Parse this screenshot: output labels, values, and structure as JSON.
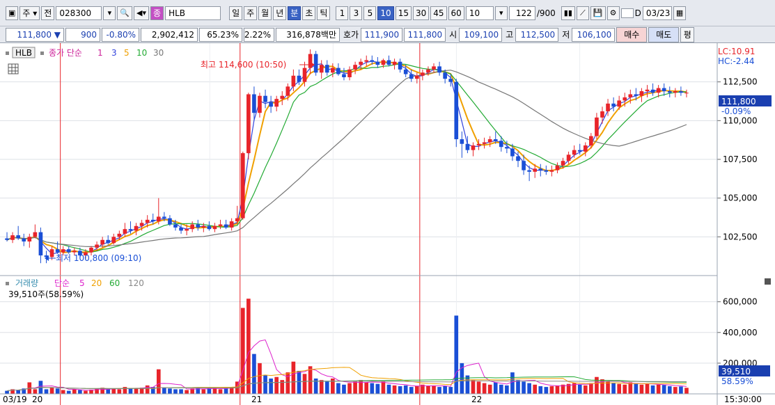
{
  "toolbar": {
    "type_label": "주",
    "prev_label": "전",
    "code": "028300",
    "name_badge": "종",
    "name": "HLB",
    "periods": [
      "일",
      "주",
      "월",
      "년",
      "분",
      "초",
      "틱"
    ],
    "selected_period": "분",
    "intervals": [
      "1",
      "3",
      "5",
      "10",
      "15",
      "30",
      "45",
      "60"
    ],
    "selected_interval": "10",
    "interval_select": "10",
    "count": "122",
    "count_total": "/900",
    "checkbox_label": "D",
    "date": "03/23"
  },
  "quote": {
    "price": "111,800",
    "change": "900",
    "change_pct": "-0.80%",
    "volume": "2,902,412",
    "vol_ratio": "65.23%",
    "turnover": "2.22%",
    "amount": "316,878백만",
    "ask_label": "호가",
    "ask": "111,900",
    "bid": "111,800",
    "open_label": "시",
    "open": "109,100",
    "high_label": "고",
    "high": "112,500",
    "low_label": "저",
    "low": "106,100",
    "buy_label": "매수",
    "sell_label": "매도",
    "eval_label": "평"
  },
  "legend": {
    "stock": "HLB",
    "ma_title": "종가 단순",
    "ma1": "1",
    "ma3": "3",
    "ma5": "5",
    "ma10": "10",
    "ma30": "30",
    "vol_title": "거래량",
    "vol_ma_title": "단순",
    "vma5": "5",
    "vma20": "20",
    "vma60": "60",
    "vma120": "120",
    "vol_info": "39,510주(58.59%)",
    "lc": "LC:10.91",
    "hc": "HC:-2.44"
  },
  "annotations": {
    "high": "최고 114,600 (10:50)",
    "low": "최저 100,800 (09:10)"
  },
  "chart_data": {
    "type": "candlestick",
    "price_ticks": [
      "112,500",
      "110,000",
      "107,500",
      "105,000",
      "102,500"
    ],
    "price_tick_values": [
      112500,
      110000,
      107500,
      105000,
      102500
    ],
    "price_range": [
      100000,
      115000
    ],
    "volume_ticks": [
      "600,000",
      "400,000",
      "200,000"
    ],
    "volume_tick_values": [
      600000,
      400000,
      200000
    ],
    "volume_range": [
      0,
      680000
    ],
    "last_price_label": "111,800",
    "last_change_label": "-0.09%",
    "last_volume_label": "39,510",
    "last_volume_pct_label": "58.59%",
    "time_axis": [
      "03/19",
      "20",
      "21",
      "22"
    ],
    "time_end": "15:30:00",
    "grid": true,
    "colors": {
      "up": "#e8242a",
      "down": "#1a4fd6",
      "ma3": "#3344dd",
      "ma5": "#f0a000",
      "ma10": "#22aa33",
      "ma30": "#777777",
      "vma5": "#dd22cc",
      "vma20": "#f0a000",
      "vma60": "#22aa33",
      "vma120": "#888888"
    },
    "candles": [
      [
        102400,
        102800,
        102200,
        102300
      ],
      [
        102300,
        102800,
        102100,
        102600
      ],
      [
        102600,
        103200,
        102300,
        102400
      ],
      [
        102400,
        102700,
        101900,
        102200
      ],
      [
        102200,
        102700,
        101800,
        102500
      ],
      [
        102500,
        103300,
        102400,
        102800
      ],
      [
        102800,
        103100,
        100800,
        101300
      ],
      [
        101300,
        101600,
        100800,
        101200
      ],
      [
        101200,
        101900,
        101000,
        101700
      ],
      [
        101700,
        102200,
        101400,
        101500
      ],
      [
        101500,
        101900,
        101300,
        101700
      ],
      [
        101700,
        101900,
        101400,
        101500
      ],
      [
        101500,
        101800,
        101300,
        101600
      ],
      [
        101600,
        101800,
        101200,
        101300
      ],
      [
        101300,
        101700,
        101100,
        101500
      ],
      [
        101500,
        101900,
        101300,
        101800
      ],
      [
        101800,
        102200,
        101600,
        102000
      ],
      [
        102000,
        102500,
        101800,
        102300
      ],
      [
        102300,
        102600,
        102000,
        102100
      ],
      [
        102100,
        102700,
        102000,
        102500
      ],
      [
        102500,
        102900,
        102300,
        102700
      ],
      [
        102700,
        103400,
        102500,
        103000
      ],
      [
        103000,
        103500,
        102700,
        102900
      ],
      [
        102900,
        103400,
        102600,
        103200
      ],
      [
        103200,
        103600,
        102900,
        103400
      ],
      [
        103400,
        103900,
        103100,
        103600
      ],
      [
        103600,
        104000,
        103300,
        103500
      ],
      [
        103500,
        105000,
        103300,
        103800
      ],
      [
        103800,
        104100,
        103500,
        103700
      ],
      [
        103700,
        103900,
        103200,
        103300
      ],
      [
        103300,
        103600,
        102900,
        103100
      ],
      [
        103100,
        103300,
        102700,
        102900
      ],
      [
        102900,
        103300,
        102600,
        103000
      ],
      [
        103000,
        103500,
        102800,
        103300
      ],
      [
        103300,
        103600,
        102900,
        103100
      ],
      [
        103100,
        103400,
        102800,
        103200
      ],
      [
        103200,
        103500,
        102900,
        103000
      ],
      [
        103000,
        103400,
        102800,
        103200
      ],
      [
        103200,
        103600,
        103000,
        103300
      ],
      [
        103300,
        103600,
        103000,
        103100
      ],
      [
        103100,
        103700,
        102900,
        103500
      ],
      [
        103500,
        104500,
        103300,
        103700
      ],
      [
        103700,
        108000,
        103600,
        107900
      ],
      [
        107900,
        111800,
        107500,
        111700
      ],
      [
        111700,
        112200,
        110000,
        110500
      ],
      [
        110500,
        111800,
        110200,
        111600
      ],
      [
        111600,
        112000,
        110800,
        111200
      ],
      [
        111200,
        111600,
        110500,
        110900
      ],
      [
        110900,
        111600,
        110600,
        111400
      ],
      [
        111400,
        111900,
        111000,
        111600
      ],
      [
        111600,
        112400,
        111300,
        112200
      ],
      [
        112200,
        113300,
        111900,
        112900
      ],
      [
        112900,
        113300,
        112300,
        112500
      ],
      [
        112500,
        113800,
        112200,
        113400
      ],
      [
        113400,
        114600,
        113000,
        114300
      ],
      [
        114300,
        114500,
        112900,
        113100
      ],
      [
        113100,
        113900,
        112700,
        113600
      ],
      [
        113600,
        113900,
        112900,
        113100
      ],
      [
        113100,
        113700,
        112800,
        113400
      ],
      [
        113400,
        113700,
        112900,
        113000
      ],
      [
        113000,
        113400,
        112600,
        112800
      ],
      [
        112800,
        113500,
        112600,
        113300
      ],
      [
        113300,
        113800,
        113000,
        113600
      ],
      [
        113600,
        114000,
        113300,
        113800
      ],
      [
        113800,
        114200,
        113500,
        113900
      ],
      [
        113900,
        114200,
        113600,
        113800
      ],
      [
        113800,
        114100,
        113400,
        113600
      ],
      [
        113600,
        114000,
        113400,
        113900
      ],
      [
        113900,
        114200,
        113500,
        113600
      ],
      [
        113600,
        114000,
        113300,
        113800
      ],
      [
        113800,
        114000,
        113100,
        113300
      ],
      [
        113300,
        113600,
        112800,
        113000
      ],
      [
        113000,
        113300,
        112500,
        112700
      ],
      [
        112700,
        113100,
        112400,
        112900
      ],
      [
        112900,
        113300,
        112600,
        113100
      ],
      [
        113100,
        113500,
        112900,
        113300
      ],
      [
        113300,
        113700,
        113100,
        113500
      ],
      [
        113500,
        113800,
        112900,
        113100
      ],
      [
        113100,
        113300,
        112400,
        112700
      ],
      [
        112700,
        113000,
        112200,
        112500
      ],
      [
        112500,
        112700,
        108300,
        108800
      ],
      [
        108800,
        109300,
        107600,
        108500
      ],
      [
        108500,
        109000,
        107900,
        108100
      ],
      [
        108100,
        108600,
        107700,
        108400
      ],
      [
        108400,
        108800,
        108100,
        108500
      ],
      [
        108500,
        108900,
        108200,
        108600
      ],
      [
        108600,
        109000,
        108300,
        108800
      ],
      [
        108800,
        109300,
        108500,
        108700
      ],
      [
        108700,
        109000,
        108000,
        108300
      ],
      [
        108300,
        108700,
        107900,
        108200
      ],
      [
        108200,
        108500,
        107400,
        107700
      ],
      [
        107700,
        108000,
        107000,
        107400
      ],
      [
        107400,
        107800,
        106500,
        106800
      ],
      [
        106800,
        107100,
        106100,
        106700
      ],
      [
        106700,
        107200,
        106300,
        106900
      ],
      [
        106900,
        107200,
        106400,
        106800
      ],
      [
        106800,
        107100,
        106500,
        106700
      ],
      [
        106700,
        107100,
        106400,
        106800
      ],
      [
        106800,
        107300,
        106600,
        107100
      ],
      [
        107100,
        107600,
        106900,
        107400
      ],
      [
        107400,
        108000,
        107200,
        107800
      ],
      [
        107800,
        108400,
        107600,
        108100
      ],
      [
        108100,
        108500,
        107800,
        108000
      ],
      [
        108000,
        108600,
        107700,
        108400
      ],
      [
        108400,
        109200,
        108200,
        109000
      ],
      [
        109000,
        110500,
        108800,
        110200
      ],
      [
        110200,
        110900,
        109800,
        110600
      ],
      [
        110600,
        111400,
        110300,
        111100
      ],
      [
        111100,
        111500,
        110600,
        110900
      ],
      [
        110900,
        111600,
        110700,
        111300
      ],
      [
        111300,
        111800,
        110900,
        111500
      ],
      [
        111500,
        112000,
        111100,
        111700
      ],
      [
        111700,
        112100,
        111300,
        111600
      ],
      [
        111600,
        112100,
        111200,
        111900
      ],
      [
        111900,
        112300,
        111500,
        112000
      ],
      [
        112000,
        112400,
        111600,
        111800
      ],
      [
        111800,
        112300,
        111500,
        112100
      ],
      [
        112100,
        112400,
        111600,
        111900
      ],
      [
        111900,
        112200,
        111500,
        111800
      ],
      [
        111800,
        112100,
        111500,
        111900
      ],
      [
        111900,
        112200,
        111600,
        111800
      ],
      [
        111800,
        112000,
        111500,
        111800
      ]
    ],
    "volumes": [
      20000,
      30000,
      25000,
      35000,
      75000,
      30000,
      85000,
      30000,
      40000,
      35000,
      25000,
      20000,
      30000,
      25000,
      20000,
      28000,
      32000,
      40000,
      30000,
      35000,
      30000,
      45000,
      35000,
      38000,
      40000,
      55000,
      45000,
      160000,
      40000,
      35000,
      30000,
      30000,
      25000,
      35000,
      40000,
      30000,
      38000,
      35000,
      30000,
      42000,
      45000,
      80000,
      560000,
      620000,
      260000,
      200000,
      120000,
      100000,
      110000,
      90000,
      140000,
      210000,
      150000,
      130000,
      180000,
      100000,
      90000,
      80000,
      100000,
      70000,
      60000,
      70000,
      80000,
      90000,
      75000,
      70000,
      65000,
      80000,
      60000,
      55000,
      50000,
      55000,
      45000,
      50000,
      60000,
      50000,
      55000,
      45000,
      50000,
      45000,
      510000,
      200000,
      120000,
      90000,
      80000,
      70000,
      60000,
      75000,
      60000,
      55000,
      140000,
      90000,
      80000,
      70000,
      60000,
      50000,
      45000,
      50000,
      55000,
      60000,
      65000,
      70000,
      60000,
      55000,
      70000,
      110000,
      95000,
      80000,
      70000,
      65000,
      60000,
      75000,
      70000,
      60000,
      65000,
      55000,
      60000,
      58000,
      50000,
      45000,
      48000,
      39510
    ]
  }
}
